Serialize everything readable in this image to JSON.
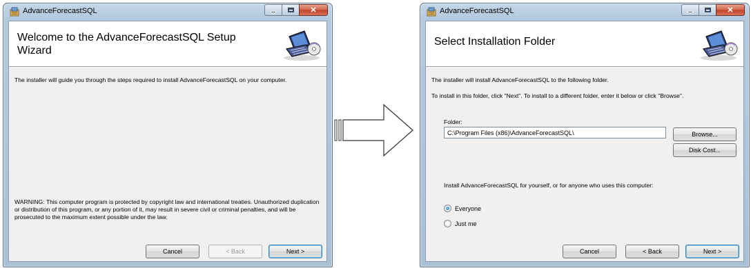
{
  "left_window": {
    "title": "AdvanceForecastSQL",
    "header_title": "Welcome to the AdvanceForecastSQL Setup Wizard",
    "intro_text": "The installer will guide you through the steps required to install AdvanceForecastSQL on your computer.",
    "warning_text": "WARNING: This computer program is protected by copyright law and international treaties. Unauthorized duplication or distribution of this program, or any portion of it, may result in severe civil or criminal penalties, and will be prosecuted to the maximum extent possible under the law.",
    "buttons": {
      "cancel": "Cancel",
      "back": "< Back",
      "next": "Next >"
    }
  },
  "right_window": {
    "title": "AdvanceForecastSQL",
    "header_title": "Select Installation Folder",
    "intro_text": "The installer will install AdvanceForecastSQL to the following folder.",
    "instruction_text": "To install in this folder, click \"Next\". To install to a different folder, enter it below or click \"Browse\".",
    "folder_label": "Folder:",
    "folder_value": "C:\\Program Files (x86)\\AdvanceForecastSQL\\",
    "browse_label": "Browse...",
    "disk_cost_label": "Disk Cost...",
    "install_for_text": "Install AdvanceForecastSQL for yourself, or for anyone who uses this computer:",
    "radio_options": [
      {
        "label": "Everyone",
        "checked": true
      },
      {
        "label": "Just me",
        "checked": false
      }
    ],
    "buttons": {
      "cancel": "Cancel",
      "back": "< Back",
      "next": "Next >"
    }
  },
  "icons": {
    "app": "installer-app-icon",
    "header": "computer-disc-icon",
    "arrow": "right-arrow-icon"
  },
  "colors": {
    "title_bar": "#b8cde2",
    "close_button": "#c8553d",
    "client_background": "#f0f0f0",
    "header_background": "#ffffff",
    "default_button_border": "#3c7fb1"
  }
}
